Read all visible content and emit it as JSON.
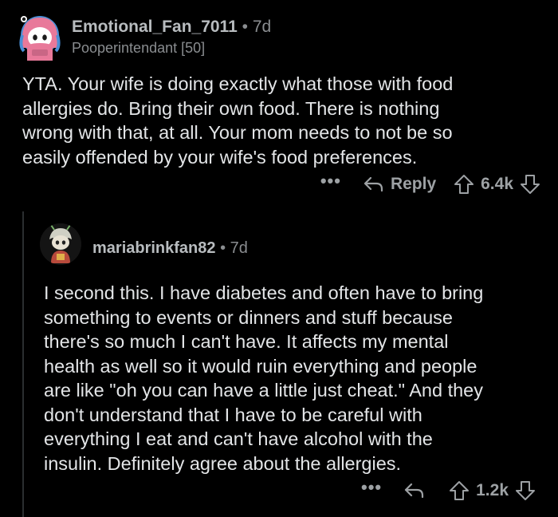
{
  "comment1": {
    "username": "Emotional_Fan_7011",
    "separator": "•",
    "age": "7d",
    "flair": "Pooperintendant [50]",
    "body_lines": [
      "YTA. Your wife is doing exactly what those with food",
      "allergies do. Bring their own food. There is nothing",
      "wrong with that, at all. Your mom needs to not be so",
      "easily offended by your wife's food preferences."
    ],
    "more_label": "•••",
    "reply_label": "Reply",
    "score": "6.4k"
  },
  "comment2": {
    "username": "mariabrinkfan82",
    "separator": "•",
    "age": "7d",
    "body_lines": [
      "I second this. I have diabetes and often have to bring",
      "something to events or dinners and stuff because",
      "there's so much I can't have. It affects my mental",
      "health as well so it would ruin everything and people",
      "are like \"oh you can have a little just cheat.\" And they",
      "don't understand that I have to be careful with",
      "everything I eat and can't have alcohol with the",
      "insulin. Definitely agree about the allergies."
    ],
    "more_label": "•••",
    "score": "1.2k"
  },
  "icons": {
    "reply": "reply-arrow-icon",
    "upvote": "upvote-arrow-icon",
    "downvote": "downvote-arrow-icon",
    "more": "more-options-icon"
  },
  "colors": {
    "background": "#000000",
    "text": "#e3e5e7",
    "muted": "#8a8d90",
    "avatar1_accent": "#e8799a",
    "avatar1_hair": "#4a8fd6"
  }
}
